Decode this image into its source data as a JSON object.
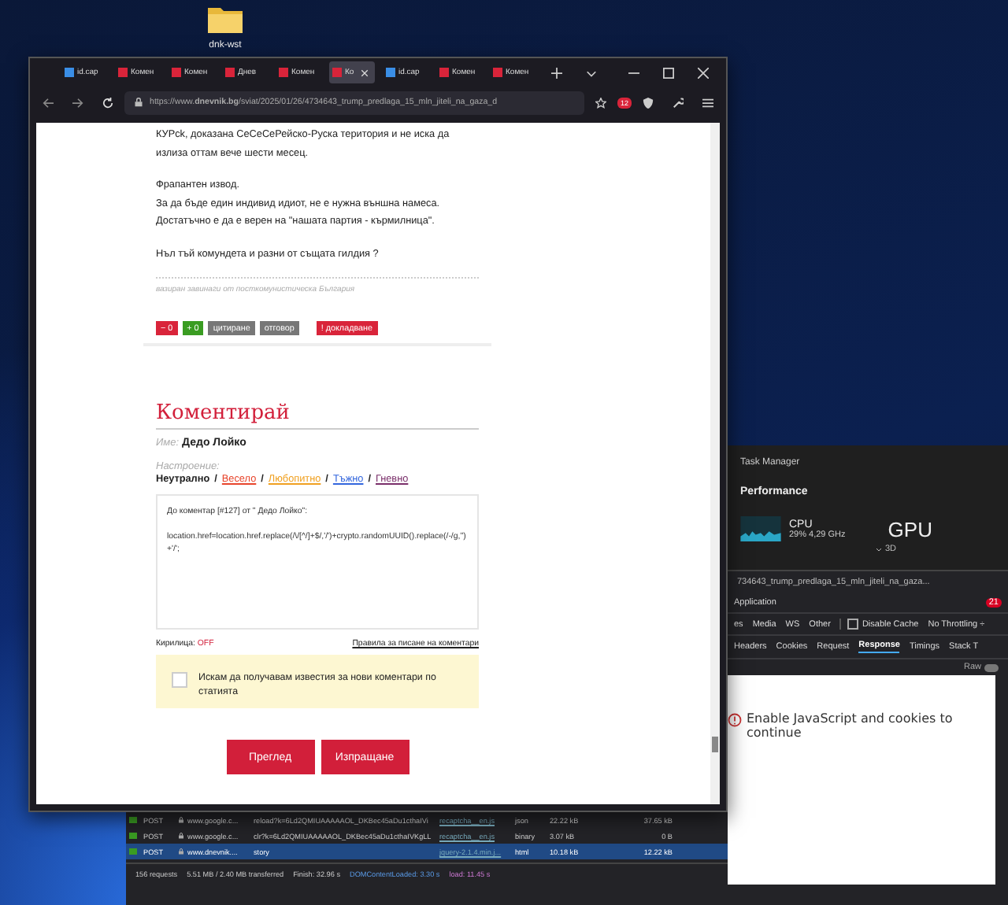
{
  "desktop": {
    "icons": [
      {
        "label": "dnk-wst"
      }
    ]
  },
  "browser": {
    "tabs": [
      {
        "label": "id.cap",
        "kind": "id",
        "selected": false
      },
      {
        "label": "Комен",
        "kind": "dn",
        "selected": false
      },
      {
        "label": "Комен",
        "kind": "dn",
        "selected": false
      },
      {
        "label": "Днев",
        "kind": "dn",
        "selected": false
      },
      {
        "label": "Комен",
        "kind": "dn",
        "selected": false
      },
      {
        "label": "Ко",
        "kind": "dn",
        "selected": true
      },
      {
        "label": "id.cap",
        "kind": "id",
        "selected": false
      },
      {
        "label": "Комен",
        "kind": "dn",
        "selected": false
      },
      {
        "label": "Комен",
        "kind": "dn",
        "selected": false
      }
    ],
    "url": "https://www.**dnevnik.bg**/sviat/2025/01/26/4734643_trump_predlaga_15_mln_jiteli_na_gaza_d",
    "notification_count": "12",
    "page": {
      "comment": {
        "paragraphs": [
          "КУРсk, доказана СеСеСеРейско-Руска територия и не иска да излиза оттам вече шести месец.",
          "Фрапантен извод.\nЗа да бъде един индивид идиот, не е нужна външна намеса.\nДостатъчно е да е верен на \"нашата партия - кърмилница\".",
          "Нъл тъй комундета и разни от същата гилдия ?"
        ],
        "signature": "вазиран завинаги от посткомунистическа България",
        "actions": [
          {
            "kind": "minus",
            "label": "− 0"
          },
          {
            "kind": "plus",
            "label": "+ 0"
          },
          {
            "kind": "quote",
            "label": "цитиране"
          },
          {
            "kind": "reply",
            "label": "отговор"
          },
          {
            "kind": "report",
            "label": "!  докладване"
          }
        ]
      },
      "form": {
        "heading": "Коментирай",
        "name_label": "Име:",
        "name": "Дедо Лойко",
        "mood_label": "Настроение:",
        "mood_separator": "/",
        "moods": [
          {
            "label": "Неутрално",
            "color": "#222222",
            "selected": true
          },
          {
            "label": "Весело",
            "color": "#e8452c",
            "selected": false
          },
          {
            "label": "Любопитно",
            "color": "#f0a020",
            "selected": false
          },
          {
            "label": "Тъжно",
            "color": "#3366dd",
            "selected": false
          },
          {
            "label": "Гневно",
            "color": "#7a2f6a",
            "selected": false
          }
        ],
        "text": "До коментар [#127] от \" Дедо Лойко\":\n\nlocation.href=location.href.replace(/\\/[^/]+$/,'/')+crypto.randomUUID().replace(/-/g,'')+'/';",
        "cyrillic_label": "Кирилица:",
        "cyrillic_state": "OFF",
        "rules_link": "Правила за писане на коментари",
        "notify": {
          "label": "Искам да получавам известия за нови коментари по статията",
          "checked": false
        },
        "buttons": [
          "Преглед",
          "Изпращане"
        ]
      }
    }
  },
  "task_manager": {
    "title": "Task Manager",
    "section": "Performance",
    "cpu": {
      "label": "CPU",
      "reading": "29% 4,29 GHz"
    },
    "gpu": {
      "label": "GPU",
      "sub": "3D"
    }
  },
  "devtools": {
    "title": "734643_trump_predlaga_15_mln_jiteli_na_gaza...",
    "panel": "Application",
    "errors": "21",
    "filters": [
      "es",
      "Media",
      "WS",
      "Other"
    ],
    "disable_cache": {
      "label": "Disable Cache",
      "checked": false
    },
    "throttling": "No Throttling ÷",
    "detail_tabs": [
      {
        "label": "Headers",
        "selected": false
      },
      {
        "label": "Cookies",
        "selected": false
      },
      {
        "label": "Request",
        "selected": false
      },
      {
        "label": "Response",
        "selected": true
      },
      {
        "label": "Timings",
        "selected": false
      },
      {
        "label": "Stack T",
        "selected": false
      }
    ],
    "raw": {
      "label": "Raw",
      "on": false
    },
    "message": "Enable JavaScript and cookies to continue",
    "requests": [
      {
        "method": "POST",
        "domain": "www.google.c...",
        "file": "reload?k=6Ld2QMIUAAAAAOL_DKBec45aDu1cthaIVi",
        "initiator": "recaptcha__en.js",
        "type": "json",
        "transferred": "22.22 kB",
        "size": "37.65 kB",
        "selected": false
      },
      {
        "method": "POST",
        "domain": "www.google.c...",
        "file": "clr?k=6Ld2QMIUAAAAAOL_DKBec45aDu1cthaIVKgLL",
        "initiator": "recaptcha__en.js",
        "type": "binary",
        "transferred": "3.07 kB",
        "size": "0 B",
        "selected": false
      },
      {
        "method": "POST",
        "domain": "www.dnevnik....",
        "file": "story",
        "initiator": "jquery-2.1.4.min.j...",
        "type": "html",
        "transferred": "10.18 kB",
        "size": "12.22 kB",
        "selected": true
      }
    ],
    "status": [
      "156 requests",
      "5.51 MB / 2.40 MB transferred",
      "Finish: 32.96 s"
    ],
    "dcl": "DOMContentLoaded: 3.30 s",
    "load": "load: 11.45 s"
  }
}
